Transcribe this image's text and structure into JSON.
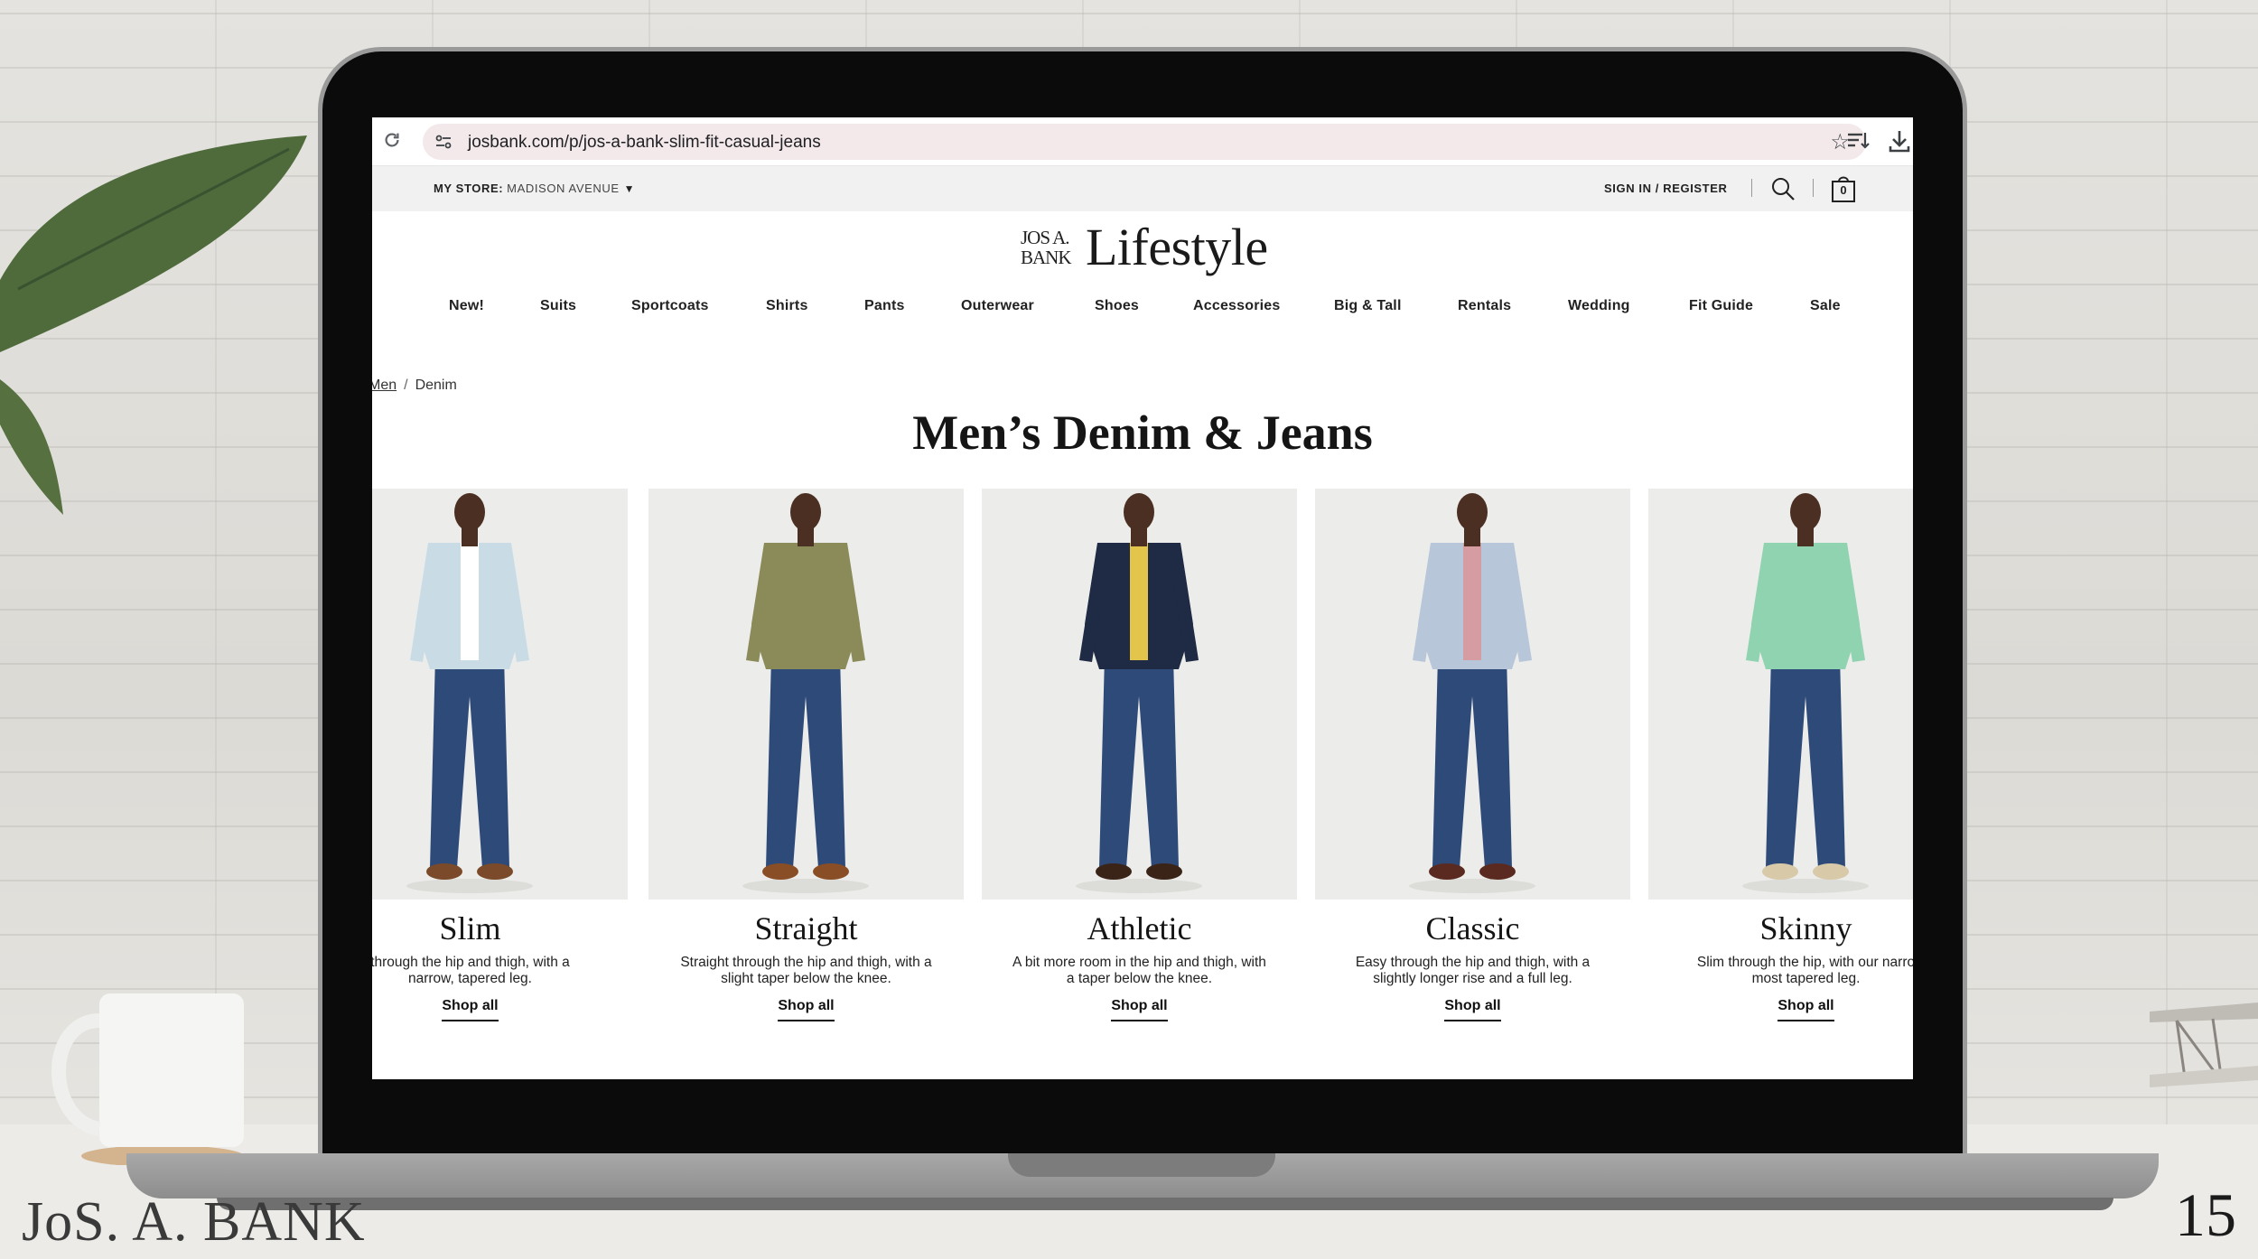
{
  "browser": {
    "url": "josbank.com/p/jos-a-bank-slim-fit-casual-jeans"
  },
  "utility": {
    "store_label": "MY STORE:",
    "store_name": "MADISON AVENUE",
    "sign_in": "SIGN IN / REGISTER",
    "bag_count": "0"
  },
  "logo": {
    "small": "JOS A. BANK",
    "small_line1": "JOS A.",
    "small_line2": "BANK",
    "main": "Lifestyle"
  },
  "nav": [
    "New!",
    "Suits",
    "Sportcoats",
    "Shirts",
    "Pants",
    "Outerwear",
    "Shoes",
    "Accessories",
    "Big & Tall",
    "Rentals",
    "Wedding",
    "Fit Guide",
    "Sale"
  ],
  "breadcrumb": {
    "parent": "Men",
    "current": "Denim"
  },
  "page_title": "Men’s Denim & Jeans",
  "products": [
    {
      "name": "Slim",
      "desc": "through the hip and thigh, with a\nnarrow, tapered leg.",
      "cta": "Shop all",
      "shirt_color": "#c9dce6",
      "accent": "#ffffff",
      "shoe": "#7a4a2a"
    },
    {
      "name": "Straight",
      "desc": "Straight through the hip and thigh, with a\nslight taper below the knee.",
      "cta": "Shop all",
      "shirt_color": "#8a8b58",
      "accent": "#8a8b58",
      "shoe": "#8a4e26"
    },
    {
      "name": "Athletic",
      "desc": "A bit more room in the hip and thigh, with\na taper below the knee.",
      "cta": "Shop all",
      "shirt_color": "#1f2a44",
      "accent": "#e3c54b",
      "shoe": "#3a2418"
    },
    {
      "name": "Classic",
      "desc": "Easy through the hip and thigh, with a\nslightly longer rise and a full leg.",
      "cta": "Shop all",
      "shirt_color": "#b7c6d8",
      "accent": "#d59ca2",
      "shoe": "#5a2a20"
    },
    {
      "name": "Skinny",
      "desc": "Slim through the hip, with our narro\nmost tapered leg.",
      "cta": "Shop all",
      "shirt_color": "#8fd3b0",
      "accent": "#8fd3b0",
      "shoe": "#d8c9a8"
    }
  ],
  "footer": {
    "brand": "JoS. A. BANK",
    "page_number": "15"
  },
  "colors": {
    "denim": "#2e4a78",
    "photo_bg": "#ececea",
    "url_bar": "#f3e9ea"
  }
}
